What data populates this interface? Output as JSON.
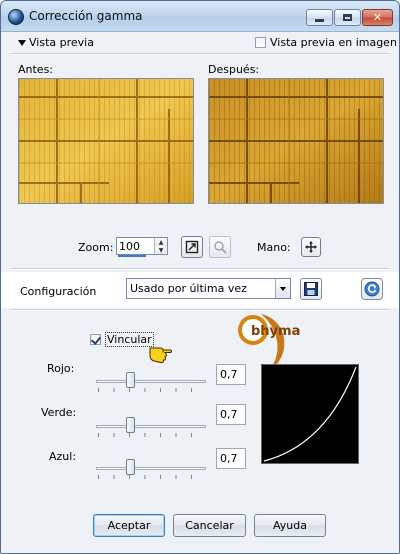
{
  "window": {
    "title": "Corrección gamma"
  },
  "preview": {
    "toggle_label": "Vista previa",
    "image_check_label": "Vista previa en imagen",
    "image_check_checked": false,
    "before_label": "Antes:",
    "after_label": "Después:"
  },
  "zoom": {
    "label": "Zoom:",
    "value": "100",
    "hand_label": "Mano:"
  },
  "config": {
    "label": "Configuración",
    "selected": "Usado por última vez"
  },
  "link": {
    "label": "Vincular",
    "checked": true
  },
  "channels": [
    {
      "label": "Rojo:",
      "value": "0,7",
      "slider_position": 0.3
    },
    {
      "label": "Verde:",
      "value": "0,7",
      "slider_position": 0.3
    },
    {
      "label": "Azul:",
      "value": "0,7",
      "slider_position": 0.3
    }
  ],
  "watermark": {
    "text": "bhyma"
  },
  "buttons": {
    "ok": "Aceptar",
    "cancel": "Cancelar",
    "help": "Ayuda"
  }
}
